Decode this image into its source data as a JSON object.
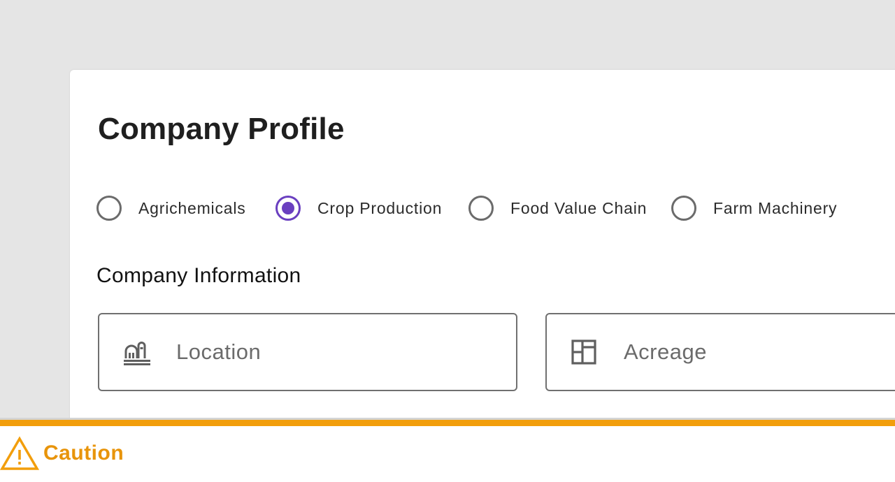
{
  "profile": {
    "title": "Company Profile",
    "categories": [
      {
        "label": "Agrichemicals",
        "selected": false
      },
      {
        "label": "Crop Production",
        "selected": true
      },
      {
        "label": "Food Value Chain",
        "selected": false
      },
      {
        "label": "Farm Machinery",
        "selected": false
      }
    ],
    "section_heading": "Company Information",
    "fields": {
      "location": {
        "value": "",
        "placeholder": "Location",
        "icon": "barn-icon"
      },
      "acreage": {
        "value": "",
        "placeholder": "Acreage",
        "icon": "field-grid-icon"
      }
    }
  },
  "caution": {
    "label": "Caution",
    "icon": "warning-triangle-icon"
  },
  "colors": {
    "accent": "#6a3fc0",
    "caution": "#f29e0c",
    "background": "#e5e5e5",
    "card": "#ffffff",
    "border": "#707070"
  }
}
